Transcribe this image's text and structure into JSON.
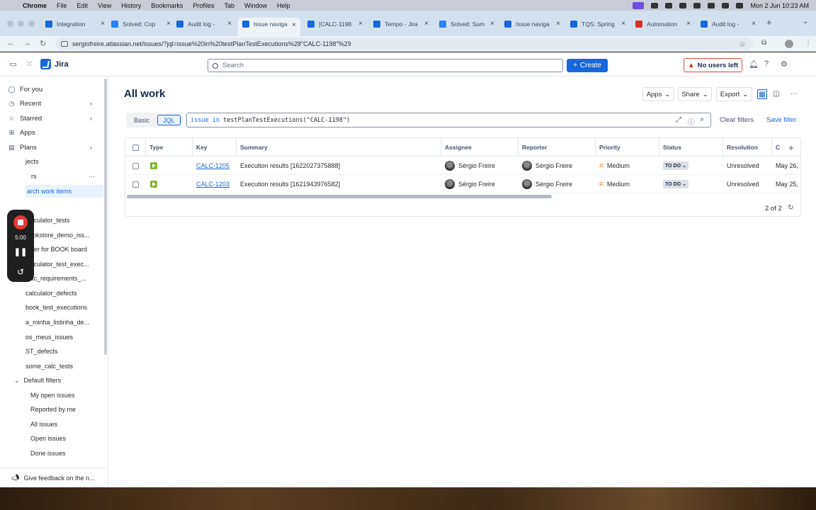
{
  "menubar": {
    "app": "Chrome",
    "items": [
      "File",
      "Edit",
      "View",
      "History",
      "Bookmarks",
      "Profiles",
      "Tab",
      "Window",
      "Help"
    ],
    "datetime": "Mon 2 Jun  10:23 AM"
  },
  "tabs": [
    {
      "label": "Integration",
      "color": "#1868db"
    },
    {
      "label": "Solved: Cop",
      "color": "#2684ff"
    },
    {
      "label": "Audit log -",
      "color": "#1868db"
    },
    {
      "label": "Issue naviga",
      "color": "#1868db"
    },
    {
      "label": "[CALC-1198",
      "color": "#1868db"
    },
    {
      "label": "Tempo - Jira",
      "color": "#1868db"
    },
    {
      "label": "Solved: Sum",
      "color": "#2684ff"
    },
    {
      "label": "Issue naviga",
      "color": "#1868db"
    },
    {
      "label": "TQS: Spring",
      "color": "#1868db"
    },
    {
      "label": "Automation",
      "color": "#d93025"
    },
    {
      "label": "Audit log -",
      "color": "#1868db"
    }
  ],
  "address": {
    "url": "sergiofreire.atlassian.net/issues/?jql=issue%20in%20testPlanTestExecutions%28\"CALC-1198\"%29"
  },
  "topnav": {
    "app_name": "Jira",
    "search_placeholder": "Search",
    "create_label": "Create",
    "no_users_label": "No users left"
  },
  "sidebar": {
    "for_you": "For you",
    "recent": "Recent",
    "starred": "Starred",
    "apps": "Apps",
    "plans": "Plans",
    "projects_partial": "jects",
    "filters_partial": "rs",
    "search_work_items": "arch work items",
    "filters": [
      "calculator_tests",
      "bookstore_demo_iss...",
      "Filter for BOOK board",
      "calculator_test_exec...",
      "calc_requirements_...",
      "calculator_defects",
      "book_test_executions",
      "a_minha_listinha_de...",
      "os_meus_issues",
      "ST_defects",
      "some_calc_tests"
    ],
    "default_filters_label": "Default filters",
    "default_filters": [
      "My open issues",
      "Reported by me",
      "All issues",
      "Open issues",
      "Done issues"
    ],
    "feedback": "Give feedback on the n..."
  },
  "recorder": {
    "time": "5:00"
  },
  "main": {
    "title": "All work",
    "apps_btn": "Apps",
    "share_btn": "Share",
    "export_btn": "Export",
    "basic": "Basic",
    "jql": "JQL",
    "jql_keywords": "issue in",
    "jql_rest": "testPlanTestExecutions(\"CALC-1198\")",
    "clear_filters": "Clear filters",
    "save_filter": "Save filter",
    "count": "2 of 2"
  },
  "table": {
    "headers": [
      "Type",
      "Key",
      "Summary",
      "Assignee",
      "Reporter",
      "Priority",
      "Status",
      "Resolution",
      "C"
    ],
    "rows": [
      {
        "key": "CALC-1205",
        "summary": "Execution results [1622027375888]",
        "assignee": "Sérgio Freire",
        "reporter": "Sérgio Freire",
        "priority": "Medium",
        "status": "TO DO",
        "resolution": "Unresolved",
        "created": "May 26,"
      },
      {
        "key": "CALC-1203",
        "summary": "Execution results [1621943976582]",
        "assignee": "Sérgio Freire",
        "reporter": "Sérgio Freire",
        "priority": "Medium",
        "status": "TO DO",
        "resolution": "Unresolved",
        "created": "May 25,"
      }
    ]
  }
}
